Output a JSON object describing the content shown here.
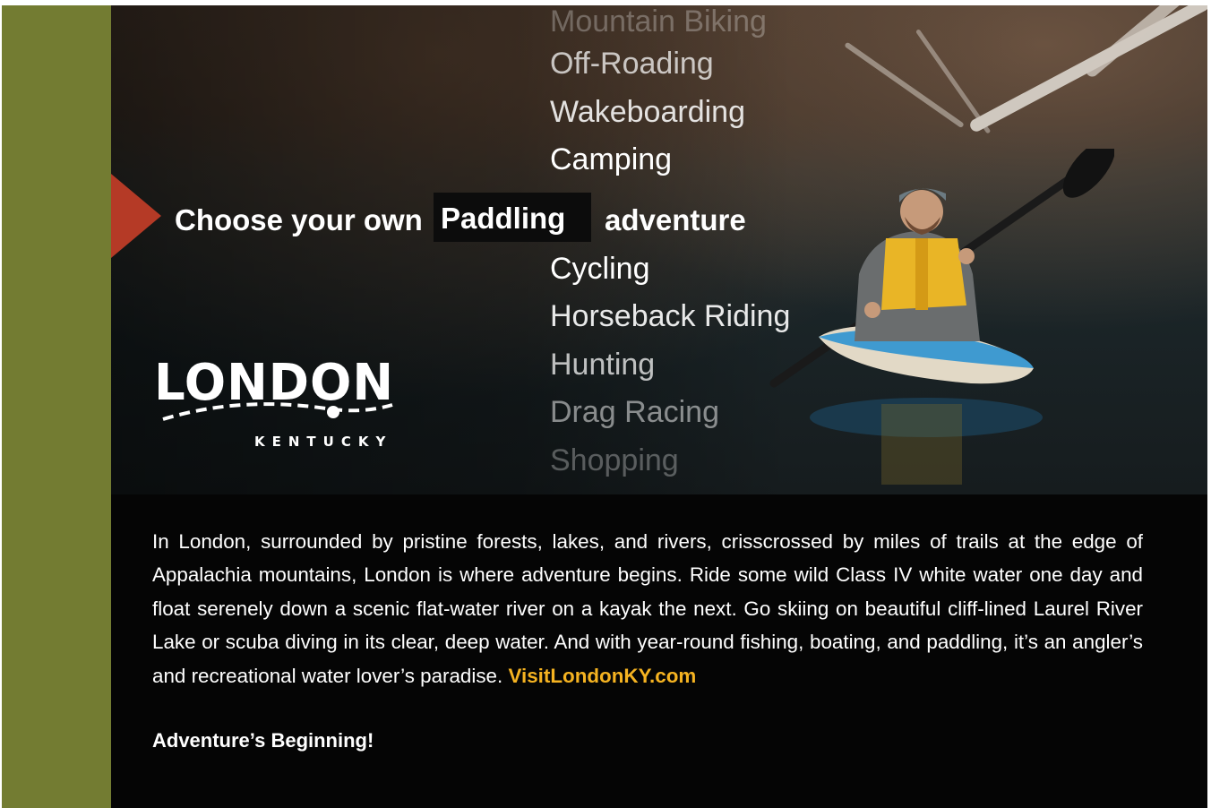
{
  "headline": {
    "prefix": "Choose your own",
    "selected": "Paddling",
    "suffix": "adventure"
  },
  "activities_above": [
    "Mountain Biking",
    "Off-Roading",
    "Wakeboarding",
    "Camping"
  ],
  "activities_below": [
    "Cycling",
    "Horseback Riding",
    "Hunting",
    "Drag Racing",
    "Shopping"
  ],
  "logo": {
    "name": "LONDON",
    "state": "KENTUCKY"
  },
  "body": {
    "paragraph": "In London, surrounded by pristine forests, lakes, and rivers, crisscrossed by miles of trails at the edge of Appalachia mountains, London is where adventure begins. Ride some wild Class IV white water one day and float serenely down a scenic flat-water river on a kayak the next. Go skiing on beautiful cliff-lined Laurel River Lake or scuba diving in its clear, deep water. And with year-round fishing, boating, and paddling, it’s an angler’s and recreational water lover’s paradise.",
    "link": "VisitLondonKY.com",
    "tagline": "Adventure’s Beginning!"
  },
  "colors": {
    "sidebar_green": "#737c32",
    "pointer_red": "#b53a26",
    "link_gold": "#f5b321",
    "background": "#050505"
  }
}
